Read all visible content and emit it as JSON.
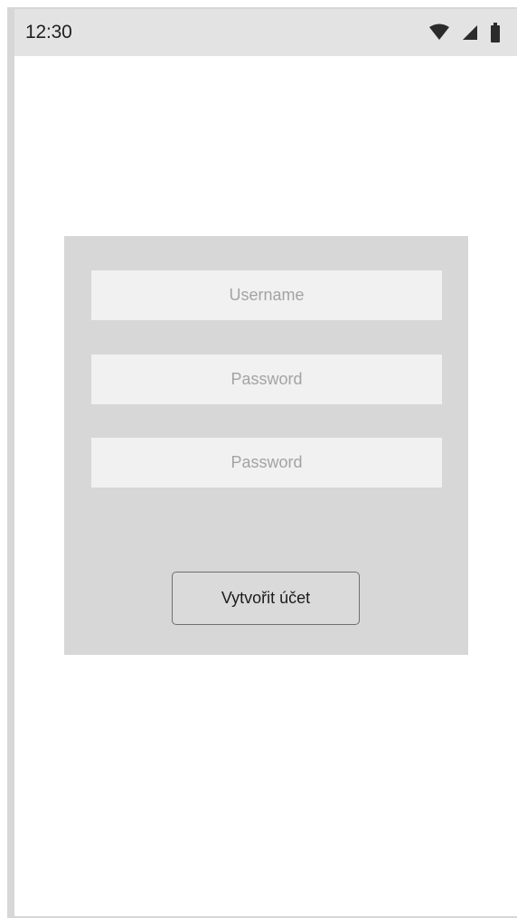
{
  "status_bar": {
    "time": "12:30",
    "icons": [
      "wifi-icon",
      "cellular-signal-icon",
      "battery-icon"
    ]
  },
  "form": {
    "username_placeholder": "Username",
    "password_placeholder": "Password",
    "password_confirm_placeholder": "Password",
    "submit_label": "Vytvořit účet"
  },
  "colors": {
    "status_bar_bg": "#e3e3e3",
    "card_bg": "#d7d7d7",
    "field_bg": "#f1f1f1",
    "placeholder_text": "#a3a3a3"
  }
}
